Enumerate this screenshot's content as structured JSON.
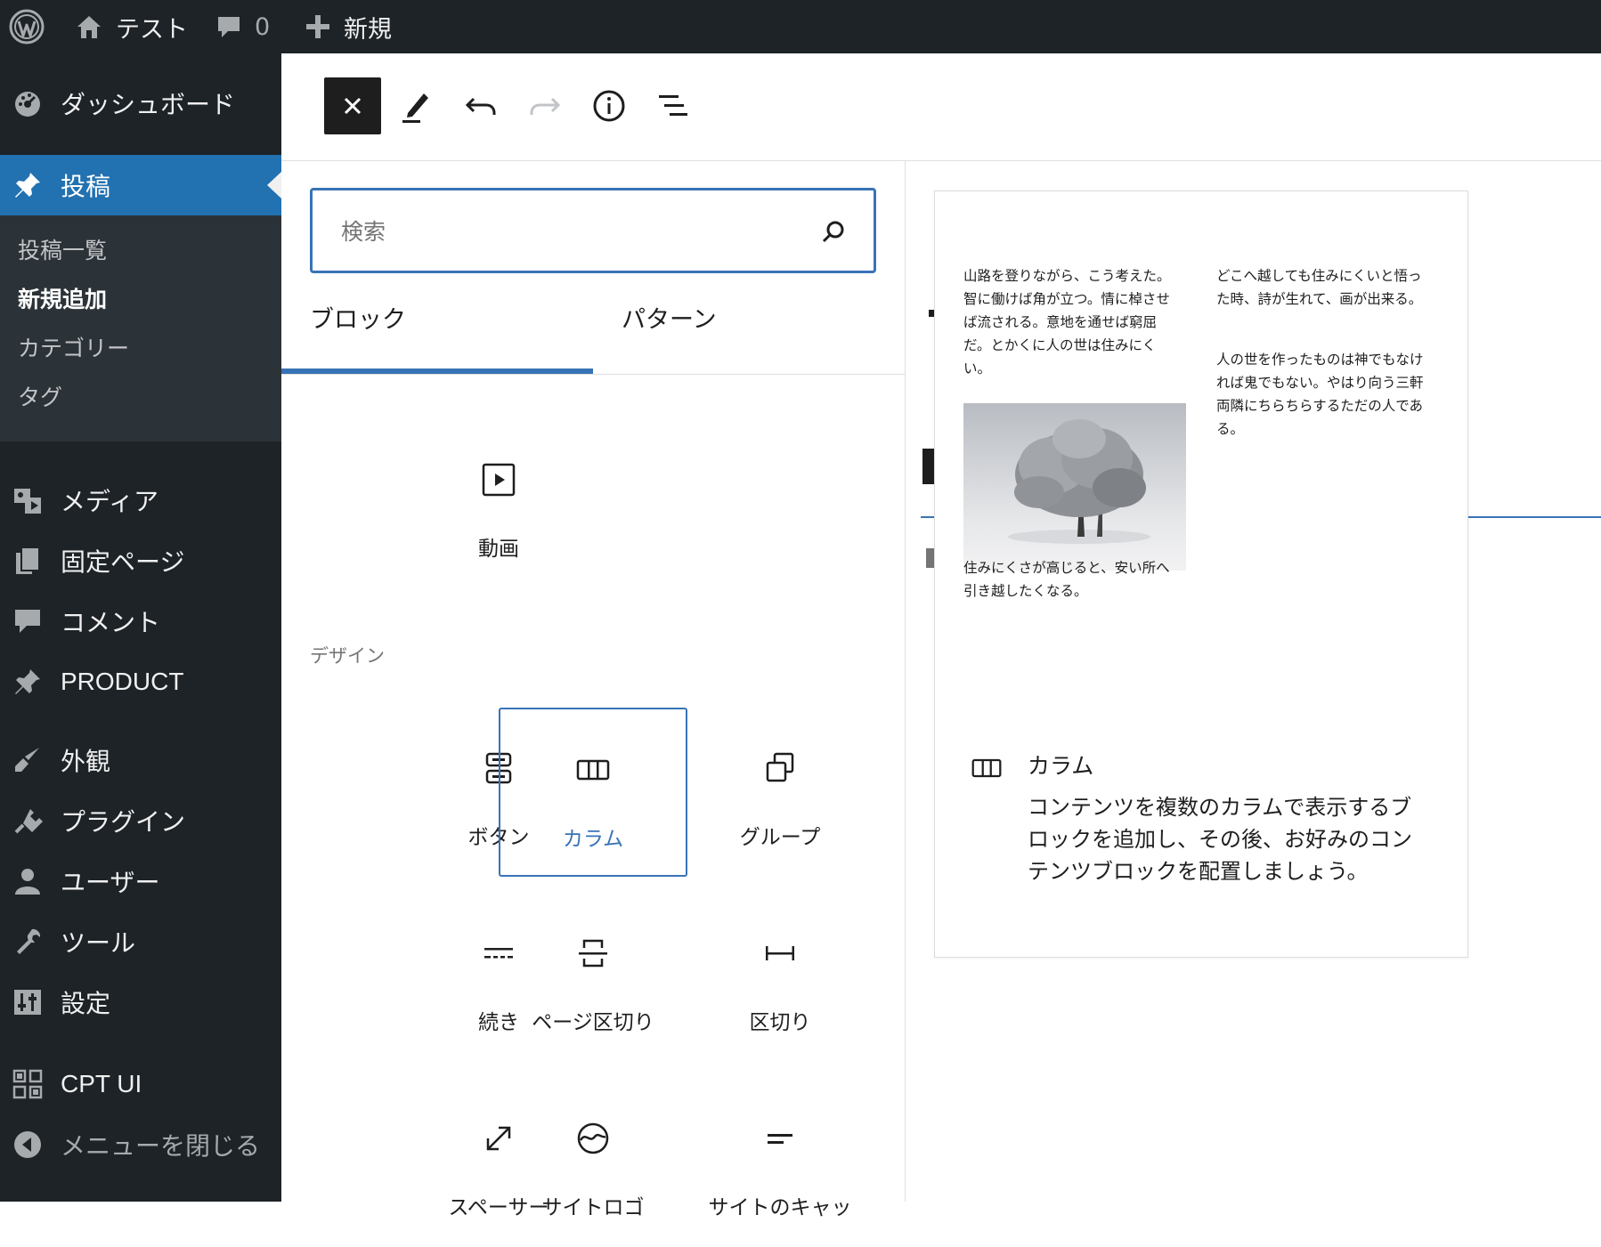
{
  "admin_bar": {
    "site_name": "テスト",
    "comments_count": "0",
    "new_label": "新規"
  },
  "sidebar": {
    "items": [
      {
        "label": "ダッシュボード"
      },
      {
        "label": "投稿"
      },
      {
        "label": "メディア"
      },
      {
        "label": "固定ページ"
      },
      {
        "label": "コメント"
      },
      {
        "label": "PRODUCT"
      },
      {
        "label": "外観"
      },
      {
        "label": "プラグイン"
      },
      {
        "label": "ユーザー"
      },
      {
        "label": "ツール"
      },
      {
        "label": "設定"
      },
      {
        "label": "CPT UI"
      },
      {
        "label": "メニューを閉じる"
      }
    ],
    "submenu": [
      "投稿一覧",
      "新規追加",
      "カテゴリー",
      "タグ"
    ]
  },
  "inserter": {
    "search_placeholder": "検索",
    "tabs": [
      "ブロック",
      "パターン"
    ],
    "media_blocks": [
      {
        "label": "動画",
        "icon": "video-icon"
      }
    ],
    "category_design": "デザイン",
    "design_blocks": [
      {
        "label": "ボタン",
        "icon": "buttons-icon"
      },
      {
        "label": "カラム",
        "icon": "columns-icon"
      },
      {
        "label": "グループ",
        "icon": "group-icon"
      },
      {
        "label": "続き",
        "icon": "more-icon"
      },
      {
        "label": "ページ区切り",
        "icon": "page-break-icon"
      },
      {
        "label": "区切り",
        "icon": "separator-icon"
      },
      {
        "label": "スペーサー",
        "icon": "spacer-icon"
      },
      {
        "label": "サイトロゴ",
        "icon": "site-logo-icon"
      },
      {
        "label": "サイトのキャッ",
        "icon": "site-tagline-icon"
      }
    ]
  },
  "preview": {
    "col1_para1": "山路を登りながら、こう考えた。智に働けば角が立つ。情に棹させば流される。意地を通せば窮屈だ。とかくに人の世は住みにくい。",
    "col1_para2": "住みにくさが高じると、安い所へ引き越したくなる。",
    "col2_para1": "どこへ越しても住みにくいと悟った時、詩が生れて、画が出来る。",
    "col2_para2": "人の世を作ったものは神でもなければ鬼でもない。やはり向う三軒両隣にちらちらするただの人である。",
    "block_title": "カラム",
    "block_description": "コンテンツを複数のカラムで表示するブロックを追加し、その後、お好みのコンテンツブロックを配置しましょう。"
  },
  "colors": {
    "accent": "#3873b6",
    "admin_dark": "#1d2327",
    "menu_current": "#2271b1"
  }
}
